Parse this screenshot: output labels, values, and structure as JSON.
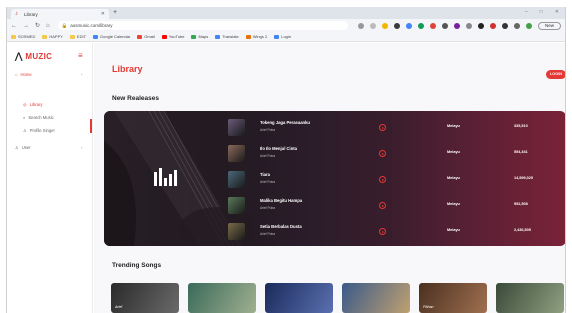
{
  "browser": {
    "tab_title": "Library",
    "url": "aosmusic.com/library",
    "profile_button": "New",
    "bookmarks": [
      {
        "label": "SOSMED",
        "color": "#f2c94c"
      },
      {
        "label": "HAPPY",
        "color": "#f2c94c"
      },
      {
        "label": "EDIT",
        "color": "#f2c94c"
      },
      {
        "label": "Google Calendar",
        "color": "#4285f4"
      },
      {
        "label": "Gmail",
        "color": "#ea4335"
      },
      {
        "label": "YouTube",
        "color": "#ff0000"
      },
      {
        "label": "Maps",
        "color": "#34a853"
      },
      {
        "label": "Translate",
        "color": "#4285f4"
      },
      {
        "label": "Wings 2",
        "color": "#e8710a"
      },
      {
        "label": "Login",
        "color": "#4285f4"
      }
    ]
  },
  "sidebar": {
    "logo_text": "MUZIC",
    "items": [
      {
        "label": "Home"
      },
      {
        "label": "Library"
      },
      {
        "label": "Search Music"
      },
      {
        "label": "Profile Singer"
      },
      {
        "label": "User"
      }
    ]
  },
  "main": {
    "page_title": "Library",
    "login_label": "LOGIN",
    "new_releases_title": "New Realeases",
    "trending_title": "Trending Songs",
    "songs": [
      {
        "title": "Tokeng Jaga Perasaanku",
        "artist": "Arief Putra",
        "genre": "Melayu",
        "plays": "335,510",
        "thumb": "#6b5a7a"
      },
      {
        "title": "Ilo Ilo Menjul Cinta",
        "artist": "Arief Putra",
        "genre": "Melayu",
        "plays": "554,341",
        "thumb": "#8a6a5a"
      },
      {
        "title": "Tiara",
        "artist": "Arief Putra",
        "genre": "Melayu",
        "plays": "14,599,025",
        "thumb": "#4a6a7a"
      },
      {
        "title": "Malika Begitu Hampa",
        "artist": "Arief Putra",
        "genre": "Melayu",
        "plays": "952,508",
        "thumb": "#5a7a5a"
      },
      {
        "title": "Setia Berbalas Dusta",
        "artist": "Arief Putra",
        "genre": "Melayu",
        "plays": "2,436,505",
        "thumb": "#7a6a4a"
      }
    ],
    "trending": [
      {
        "label": "Arief",
        "color_a": "#2a2a2a",
        "color_b": "#6a6a6a"
      },
      {
        "label": "",
        "color_a": "#3a6a5a",
        "color_b": "#a0b090"
      },
      {
        "label": "",
        "color_a": "#1a2a5a",
        "color_b": "#5a70b0"
      },
      {
        "label": "",
        "color_a": "#3a5a8a",
        "color_b": "#c0a070"
      },
      {
        "label": "Pilihan",
        "color_a": "#4a3020",
        "color_b": "#a07050"
      },
      {
        "label": "",
        "color_a": "#3a4a3a",
        "color_b": "#90a080"
      },
      {
        "label": "",
        "color_a": "#5a5a5a",
        "color_b": "#c0c0c0"
      }
    ]
  },
  "colors": {
    "accent": "#e53935",
    "banner_dark": "#171318",
    "banner_red": "#7a2238"
  }
}
